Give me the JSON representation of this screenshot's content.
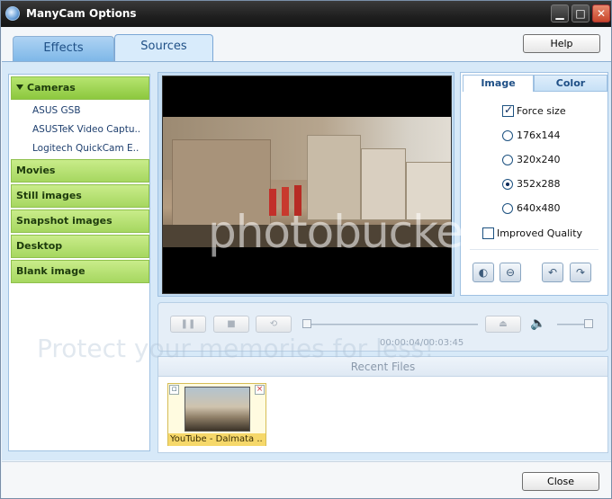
{
  "window": {
    "title": "ManyCam Options",
    "minimize_label": "▁",
    "maximize_label": "□",
    "close_label": "✕"
  },
  "tabs": [
    {
      "label": "Effects"
    },
    {
      "label": "Sources"
    }
  ],
  "help_button": "Help",
  "sources": {
    "categories": [
      {
        "label": "Cameras",
        "expanded": true,
        "items": [
          "ASUS GSB",
          "ASUSTeK Video Captu..",
          "Logitech QuickCam E.."
        ]
      },
      {
        "label": "Movies"
      },
      {
        "label": "Still images"
      },
      {
        "label": "Snapshot images"
      },
      {
        "label": "Desktop"
      },
      {
        "label": "Blank image"
      }
    ]
  },
  "image_panel": {
    "tabs": [
      {
        "label": "Image"
      },
      {
        "label": "Color"
      }
    ],
    "force_size": {
      "label": "Force size",
      "checked": true
    },
    "sizes": [
      {
        "label": "176x144",
        "selected": false
      },
      {
        "label": "320x240",
        "selected": false
      },
      {
        "label": "352x288",
        "selected": true
      },
      {
        "label": "640x480",
        "selected": false
      }
    ],
    "improved_quality": {
      "label": "Improved Quality",
      "checked": false
    }
  },
  "playback": {
    "time": "00:00:04/00:03:45"
  },
  "recent_files": {
    "title": "Recent Files",
    "items": [
      {
        "caption": "YouTube - Dalmata .."
      }
    ]
  },
  "close_button": "Close",
  "watermark": {
    "line1": "photobucket",
    "line2": "Protect your memories for less!"
  },
  "icons": {
    "play_pause": "pause-icon",
    "stop": "stop-icon",
    "loop": "loop-icon",
    "eject": "eject-icon",
    "volume": "volume-icon",
    "flip_h": "flip-horizontal-icon",
    "flip_v": "flip-vertical-icon",
    "rotate_left": "rotate-left-icon",
    "rotate_right": "rotate-right-icon"
  }
}
